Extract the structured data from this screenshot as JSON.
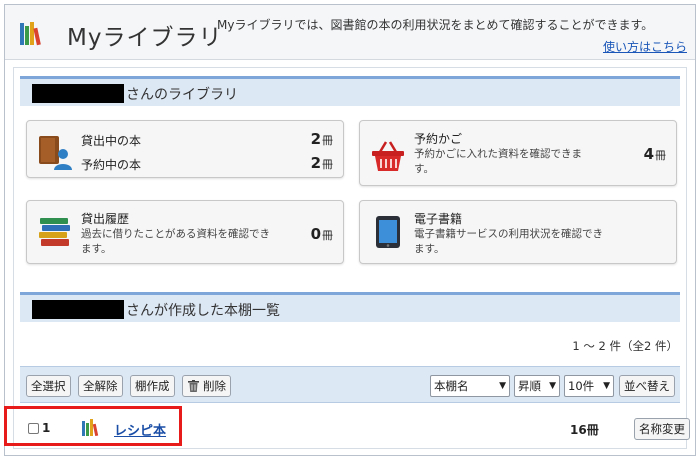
{
  "header": {
    "title": "Myライブラリ",
    "description": "Myライブラリでは、図書館の本の利用状況をまとめて確認することができます。",
    "help_link": "使い方はこちら"
  },
  "library_section": {
    "title_suffix": "さんのライブラリ"
  },
  "cards": {
    "loans": {
      "label": "貸出中の本",
      "count": "2",
      "reserve_label": "予約中の本",
      "reserve_count": "2",
      "unit": "冊"
    },
    "cart": {
      "label": "予約かご",
      "sub": "予約かごに入れた資料を確認できます。",
      "count": "4",
      "unit": "冊"
    },
    "history": {
      "label": "貸出履歴",
      "sub": "過去に借りたことがある資料を確認できます。",
      "count": "0",
      "unit": "冊"
    },
    "ebook": {
      "label": "電子書籍",
      "sub": "電子書籍サービスの利用状況を確認できます。"
    }
  },
  "shelf_section": {
    "title_suffix": "さんが作成した本棚一覧",
    "count_text": "1 ～ 2 件（全2 件）"
  },
  "toolbar": {
    "select_all": "全選択",
    "deselect_all": "全解除",
    "create_shelf": "棚作成",
    "delete": "削除",
    "sort_field": "本棚名",
    "sort_order": "昇順",
    "per_page": "10件",
    "sort_button": "並べ替え"
  },
  "shelves": [
    {
      "index": "1",
      "name": "レシピ本",
      "count": "16冊",
      "rename": "名称変更"
    }
  ],
  "colors": {
    "accent": "#7fa6d8",
    "section_bg": "#dde8f5",
    "link": "#1a56b8",
    "highlight": "#e81b1b"
  }
}
